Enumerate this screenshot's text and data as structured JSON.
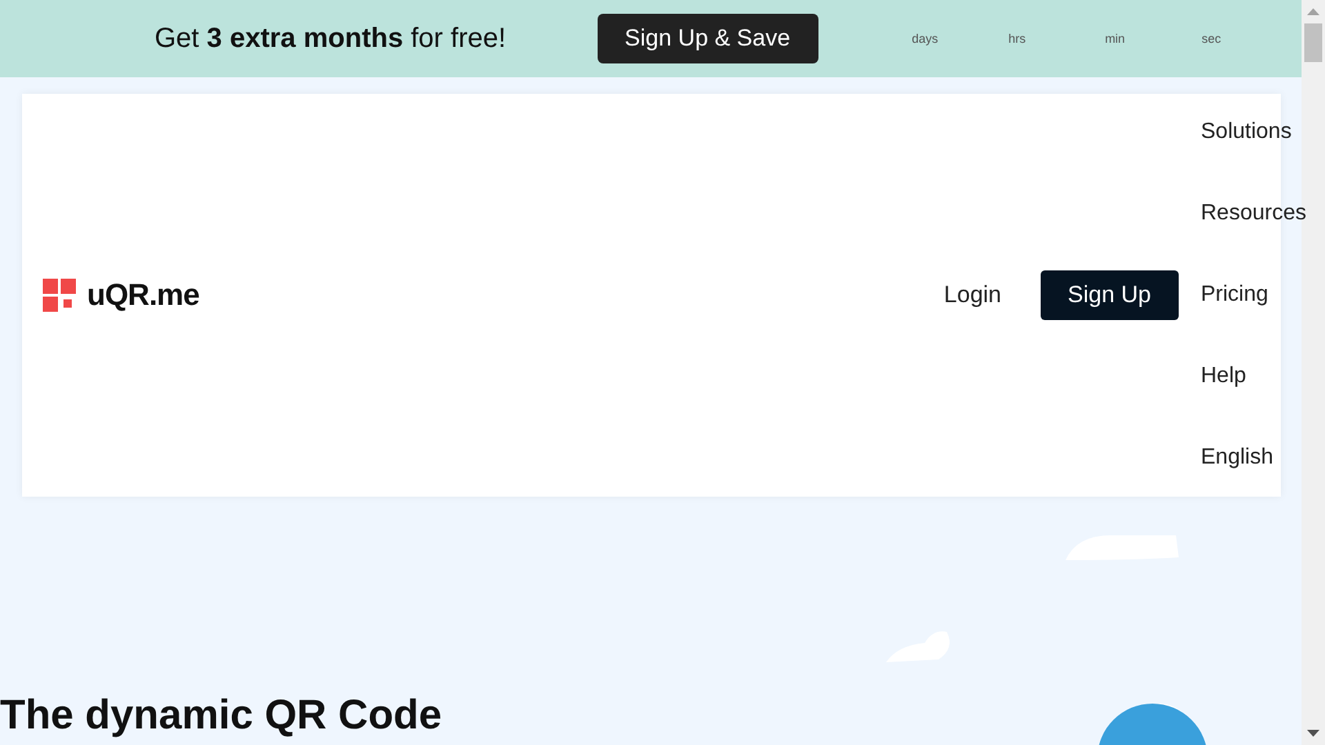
{
  "promo_bar": {
    "message": "Get **3 extra months** for free!",
    "button": "Sign Up & Save",
    "countdown": [
      "days",
      "hrs",
      "min",
      "sec"
    ]
  },
  "header": {
    "logo": "uQR.me",
    "login": "Login",
    "signup": "Sign Up",
    "menu": [
      "Solutions",
      "Resources",
      "Pricing",
      "Help",
      "English"
    ]
  },
  "hero": {
    "heading": "The dynamic QR Code"
  }
}
